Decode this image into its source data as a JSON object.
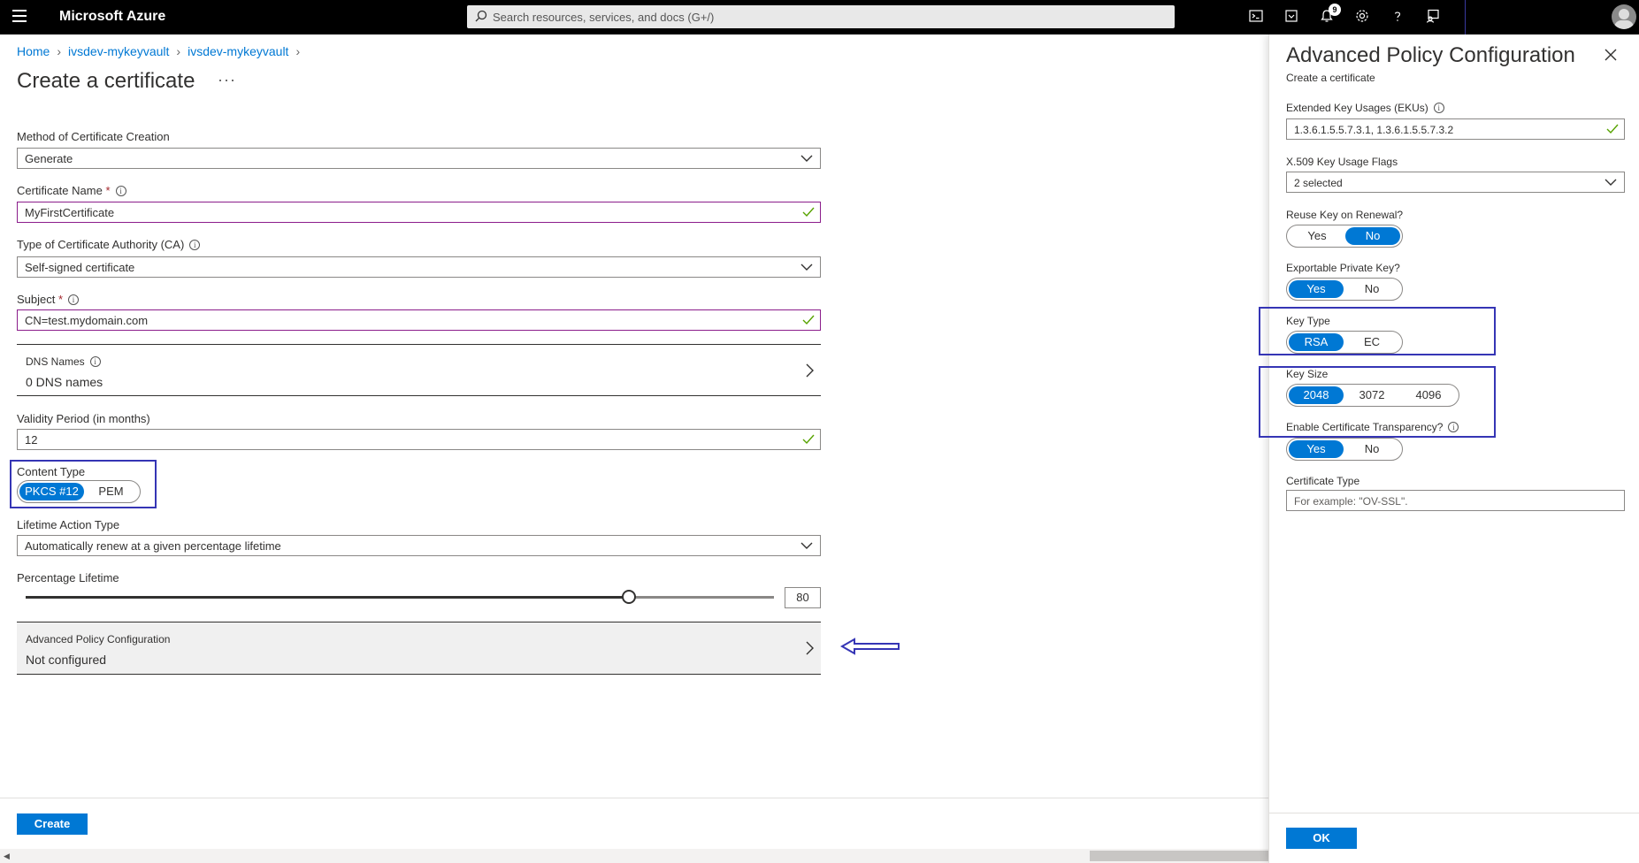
{
  "topbar": {
    "brand": "Microsoft Azure",
    "search_placeholder": "Search resources, services, and docs (G+/)",
    "notification_count": "9"
  },
  "breadcrumb": [
    "Home",
    "ivsdev-mykeyvault",
    "ivsdev-mykeyvault"
  ],
  "page": {
    "title": "Create a certificate",
    "more": "···"
  },
  "form": {
    "method_label": "Method of Certificate Creation",
    "method_value": "Generate",
    "cert_name_label": "Certificate Name",
    "cert_name_value": "MyFirstCertificate",
    "ca_type_label": "Type of Certificate Authority (CA)",
    "ca_type_value": "Self-signed certificate",
    "subject_label": "Subject",
    "subject_value": "CN=test.mydomain.com",
    "dns_label": "DNS Names",
    "dns_value": "0 DNS names",
    "validity_label": "Validity Period (in months)",
    "validity_value": "12",
    "content_type_label": "Content Type",
    "content_type_options": [
      "PKCS #12",
      "PEM"
    ],
    "content_type_selected": "PKCS #12",
    "lifetime_action_label": "Lifetime Action Type",
    "lifetime_action_value": "Automatically renew at a given percentage lifetime",
    "percentage_label": "Percentage Lifetime",
    "percentage_value": "80",
    "advanced_label": "Advanced Policy Configuration",
    "advanced_value": "Not configured",
    "create_button": "Create"
  },
  "panel": {
    "title": "Advanced Policy Configuration",
    "subtitle": "Create a certificate",
    "eku_label": "Extended Key Usages (EKUs)",
    "eku_value": "1.3.6.1.5.5.7.3.1, 1.3.6.1.5.5.7.3.2",
    "x509_label": "X.509 Key Usage Flags",
    "x509_value": "2 selected",
    "reuse_key_label": "Reuse Key on Renewal?",
    "reuse_key_options": [
      "Yes",
      "No"
    ],
    "reuse_key_selected": "No",
    "exportable_label": "Exportable Private Key?",
    "exportable_options": [
      "Yes",
      "No"
    ],
    "exportable_selected": "Yes",
    "key_type_label": "Key Type",
    "key_type_options": [
      "RSA",
      "EC"
    ],
    "key_type_selected": "RSA",
    "key_size_label": "Key Size",
    "key_size_options": [
      "2048",
      "3072",
      "4096"
    ],
    "key_size_selected": "2048",
    "transparency_label": "Enable Certificate Transparency?",
    "transparency_options": [
      "Yes",
      "No"
    ],
    "transparency_selected": "Yes",
    "cert_type_label": "Certificate Type",
    "cert_type_placeholder": "For example: \"OV-SSL\".",
    "ok_button": "OK"
  },
  "colors": {
    "accent": "#0078d4",
    "highlight_box": "#3535b5",
    "topbar": "#000000",
    "valid_border": "#8b1d8b",
    "check": "#57a300"
  }
}
